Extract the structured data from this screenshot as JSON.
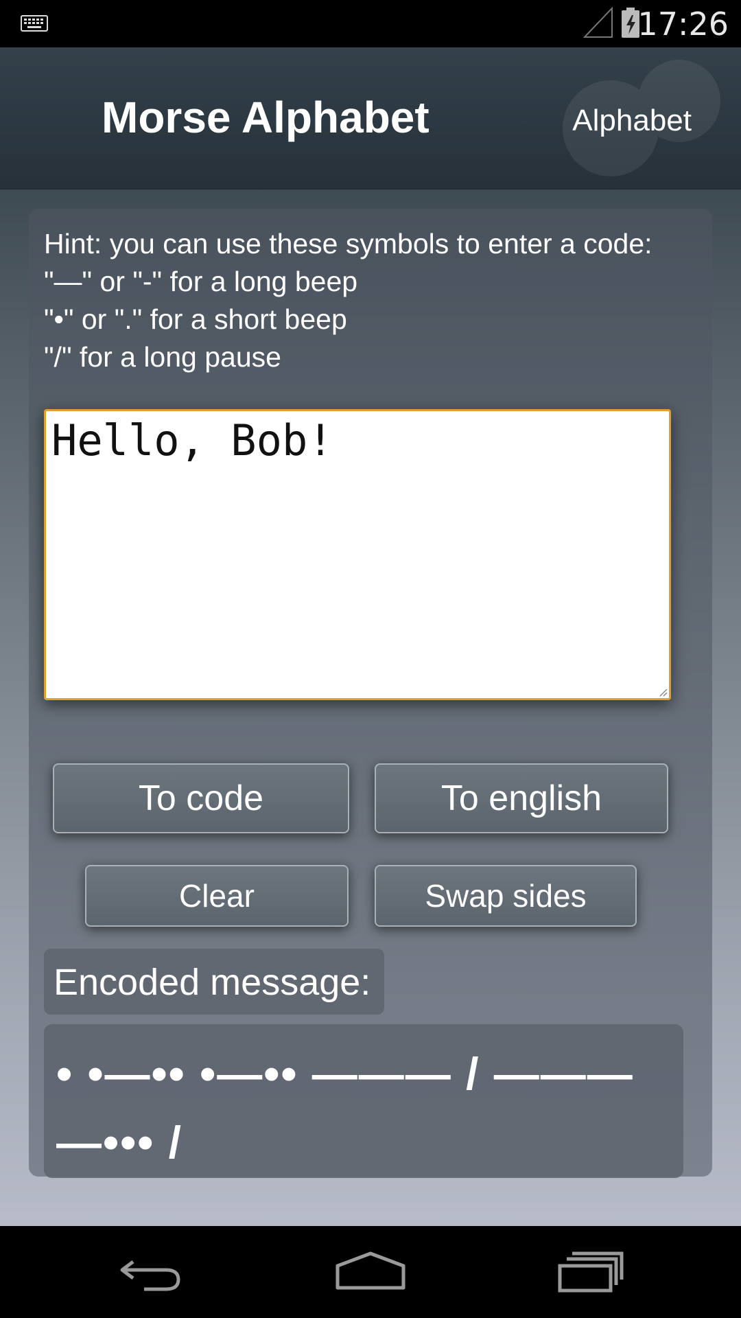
{
  "status_bar": {
    "time": "17:26",
    "icons": [
      "keyboard-icon",
      "signal-icon",
      "battery-charging-icon"
    ]
  },
  "action_bar": {
    "title": "Morse Alphabet",
    "menu_item": "Alphabet"
  },
  "hint": {
    "lines": [
      "Hint: you can use these symbols to enter a code:",
      "\"—\" or \"-\" for a long beep",
      "\"•\" or \".\" for a short beep",
      "\"/\" for a long pause"
    ]
  },
  "input": {
    "value": "Hello, Bob!"
  },
  "buttons": {
    "to_code": "To code",
    "to_english": "To english",
    "clear": "Clear",
    "swap_sides": "Swap sides"
  },
  "output": {
    "label": "Encoded message:",
    "value": "• •—•• •—•• ——— / ——— —••• /"
  },
  "nav_bar": {
    "icons": [
      "back-icon",
      "home-icon",
      "recents-icon"
    ]
  },
  "colors": {
    "input_focus_border": "#e0a030",
    "action_bar": "#2c3840"
  }
}
